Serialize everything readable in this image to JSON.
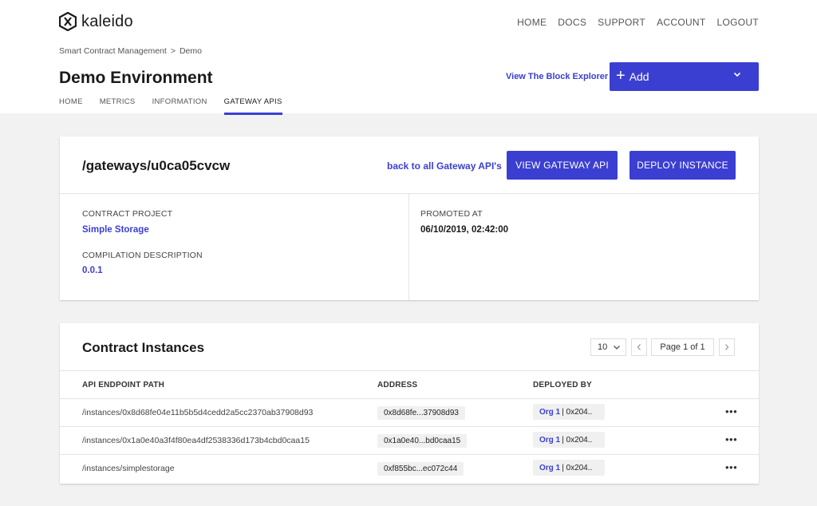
{
  "brand": {
    "name": "kaleido"
  },
  "topnav": [
    "HOME",
    "DOCS",
    "SUPPORT",
    "ACCOUNT",
    "LOGOUT"
  ],
  "breadcrumb": {
    "parent": "Smart Contract Management",
    "separator": ">",
    "current": "Demo"
  },
  "page": {
    "title": "Demo Environment"
  },
  "header_actions": {
    "explorer_link": "View The Block Explorer",
    "add_label": "Add"
  },
  "tabs": [
    {
      "label": "HOME",
      "active": false
    },
    {
      "label": "METRICS",
      "active": false
    },
    {
      "label": "INFORMATION",
      "active": false
    },
    {
      "label": "GATEWAY APIS",
      "active": true
    }
  ],
  "gateway": {
    "title": "/gateways/u0ca05cvcw",
    "back_link": "back to all Gateway API's",
    "view_button": "VIEW GATEWAY API",
    "deploy_button": "DEPLOY INSTANCE",
    "contract_project_label": "CONTRACT PROJECT",
    "contract_project_value": "Simple Storage",
    "compilation_label": "COMPILATION DESCRIPTION",
    "compilation_value": "0.0.1",
    "promoted_label": "PROMOTED AT",
    "promoted_value": "06/10/2019, 02:42:00"
  },
  "instances": {
    "title": "Contract Instances",
    "page_size": "10",
    "page_text": "Page 1 of 1",
    "columns": {
      "path": "API ENDPOINT PATH",
      "address": "ADDRESS",
      "deployed_by": "DEPLOYED BY"
    },
    "rows": [
      {
        "path": "/instances/0x8d68fe04e11b5b5d4cedd2a5cc2370ab37908d93",
        "address": "0x8d68fe...37908d93",
        "org": "Org 1",
        "org_addr": "| 0x204.."
      },
      {
        "path": "/instances/0x1a0e40a3f4f80ea4df2538336d173b4cbd0caa15",
        "address": "0x1a0e40...bd0caa15",
        "org": "Org 1",
        "org_addr": "| 0x204.."
      },
      {
        "path": "/instances/simplestorage",
        "address": "0xf855bc...ec072c44",
        "org": "Org 1",
        "org_addr": "| 0x204.."
      }
    ]
  },
  "colors": {
    "accent": "#3b3fd1",
    "link": "#3a3fd0",
    "page_bg": "#f2f2f2"
  },
  "icons": {
    "logo": "kaleido-hex-logo-icon",
    "add": "plus-icon",
    "dropdown": "chevron-down-icon",
    "prev": "chevron-left-icon",
    "next": "chevron-right-icon",
    "menu": "more-horizontal-icon"
  }
}
